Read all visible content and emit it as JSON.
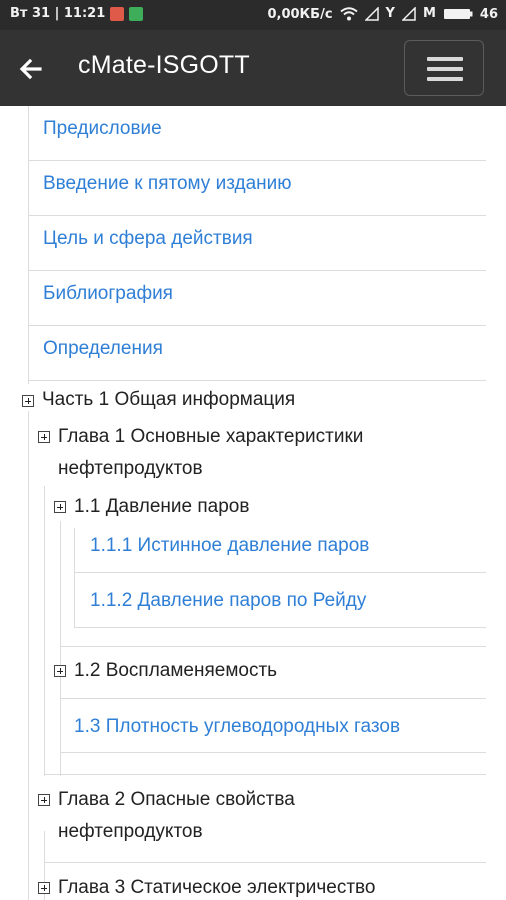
{
  "status_bar": {
    "datetime": "Вт 31 | 11:21",
    "network_speed": "0,00КБ/с",
    "carrier_label": "Y",
    "m_label": "M",
    "battery": "46",
    "icons": [
      "notification-red-icon",
      "notification-green-icon",
      "wifi-icon",
      "signal-icon",
      "battery-icon"
    ]
  },
  "app_bar": {
    "title": "cMate-ISGOTT",
    "back_icon": "arrow-left-icon",
    "menu_icon": "hamburger-menu-icon"
  },
  "colors": {
    "link": "#2f7fd6",
    "appbar": "#333333",
    "statusbar": "#2b2b2b"
  },
  "toc": {
    "top_items": [
      "Предисловие",
      "Введение к пятому изданию",
      "Цель и сфера действия",
      "Библиография",
      "Определения"
    ],
    "part1": "Часть 1 Общая информация",
    "chapter1_line1": "Глава 1 Основные характеристики",
    "chapter1_line2": "нефтепродуктов",
    "section_1_1": "1.1 Давление паров",
    "section_1_1_1": "1.1.1 Истинное давление паров",
    "section_1_1_2": "1.1.2 Давление паров по Рейду",
    "section_1_2": "1.2 Воспламеняемость",
    "section_1_3": "1.3 Плотность углеводородных газов",
    "chapter2_line1": "Глава 2 Опасные свойства",
    "chapter2_line2": "нефтепродуктов",
    "chapter3": "Глава 3 Статическое электричество"
  }
}
